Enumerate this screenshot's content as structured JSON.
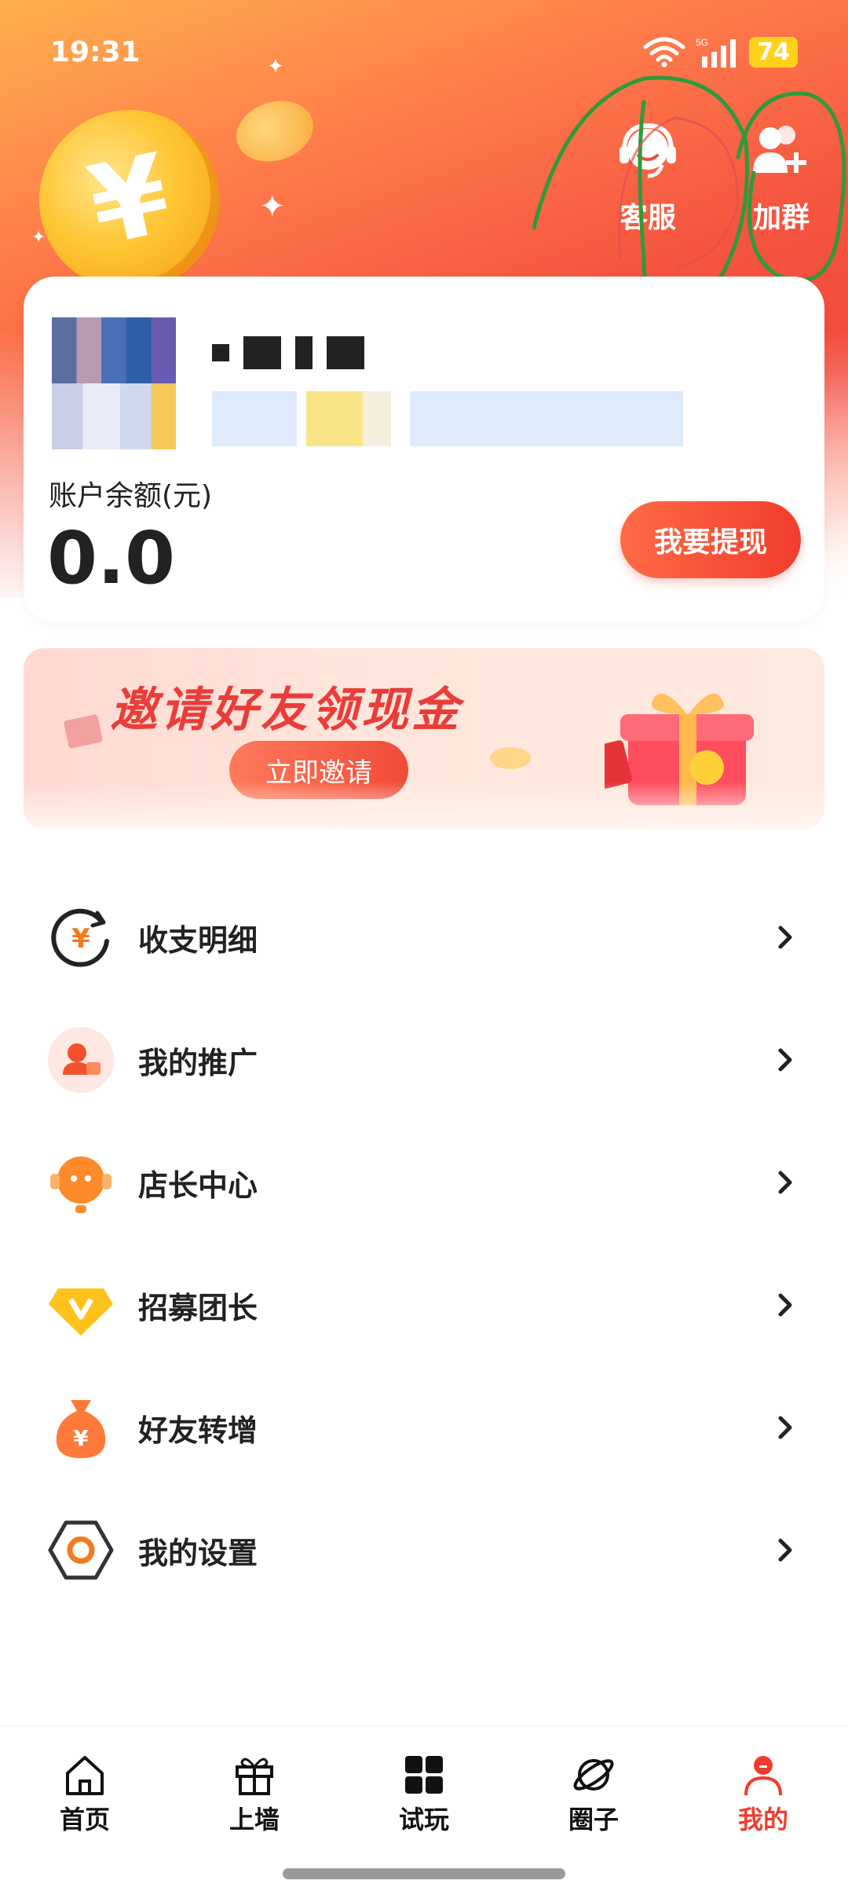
{
  "status_bar": {
    "time": "19:31",
    "network": "5G",
    "battery": "74"
  },
  "header": {
    "actions": [
      {
        "label": "客服",
        "icon": "headset-icon"
      },
      {
        "label": "加群",
        "icon": "add-group-icon"
      }
    ]
  },
  "account": {
    "balance_label": "账户余额(元)",
    "balance_value": "0.0",
    "withdraw_label": "我要提现"
  },
  "invite_banner": {
    "title": "邀请好友领现金",
    "button_label": "立即邀请"
  },
  "menu": {
    "items": [
      {
        "label": "收支明细",
        "icon": "income-expense-icon"
      },
      {
        "label": "我的推广",
        "icon": "promotion-icon"
      },
      {
        "label": "店长中心",
        "icon": "store-manager-icon"
      },
      {
        "label": "招募团长",
        "icon": "recruit-leader-icon"
      },
      {
        "label": "好友转增",
        "icon": "money-bag-icon"
      },
      {
        "label": "我的设置",
        "icon": "settings-icon"
      }
    ]
  },
  "bottom_nav": {
    "items": [
      {
        "label": "首页",
        "icon": "home-icon"
      },
      {
        "label": "上墙",
        "icon": "gift-icon"
      },
      {
        "label": "试玩",
        "icon": "grid-icon"
      },
      {
        "label": "圈子",
        "icon": "planet-icon"
      },
      {
        "label": "我的",
        "icon": "profile-icon",
        "active": true
      }
    ]
  },
  "colors": {
    "accent": "#f13c2d",
    "header_gradient_start": "#ffb04d",
    "header_gradient_end": "#f24a3d"
  }
}
